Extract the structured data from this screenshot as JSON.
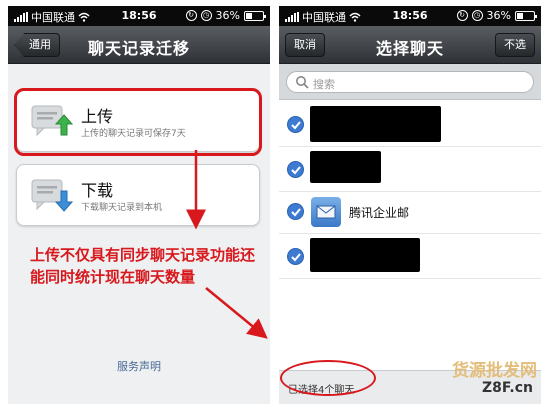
{
  "status": {
    "carrier": "中国联通",
    "time": "18:56",
    "battery": "36%"
  },
  "left_screen": {
    "back_label": "通用",
    "title": "聊天记录迁移",
    "upload": {
      "title": "上传",
      "subtitle": "上传的聊天记录可保存7天"
    },
    "download": {
      "title": "下载",
      "subtitle": "下载聊天记录到本机"
    },
    "service_label": "服务声明"
  },
  "annotation": "上传不仅具有同步聊天记录功能还能同时统计现在聊天数量",
  "right_screen": {
    "cancel_label": "取消",
    "title": "选择聊天",
    "deselect_label": "不选",
    "search_placeholder": "搜索",
    "chats": [
      {
        "label": ""
      },
      {
        "label": ""
      },
      {
        "label": "腾讯企业邮"
      },
      {
        "label": ""
      }
    ],
    "selected_count": "已选择4个聊天"
  },
  "watermark": {
    "line1": "货源批发网",
    "line2": "Z8F.cn"
  },
  "colors": {
    "annotation_red": "#d8181c",
    "check_blue": "#3d7bd3",
    "upload_arrow": "#3bb34a",
    "download_arrow": "#3b8fd8"
  }
}
